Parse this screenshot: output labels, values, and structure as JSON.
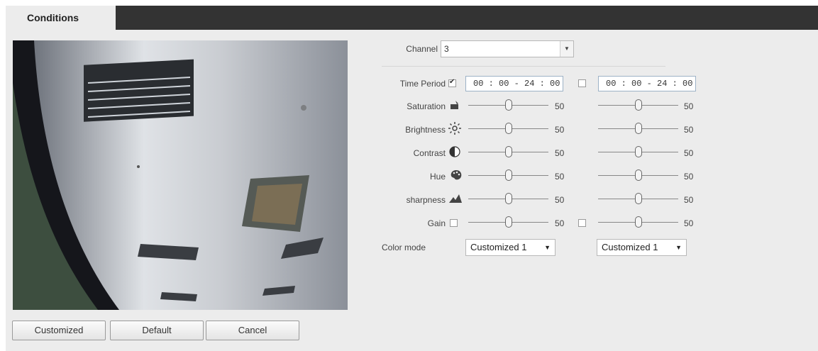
{
  "tabs": [
    {
      "label": "Conditions"
    }
  ],
  "channel": {
    "label": "Channel",
    "value": "3"
  },
  "time_period": {
    "label": "Time Period",
    "col1": {
      "checked": true,
      "value": "00 : 00 - 24 : 00"
    },
    "col2": {
      "checked": false,
      "value": "00 : 00 - 24 : 00"
    }
  },
  "rows": [
    {
      "label": "Saturation",
      "icon": "saturation-icon",
      "col1": 50,
      "col2": 50
    },
    {
      "label": "Brightness",
      "icon": "brightness-icon",
      "col1": 50,
      "col2": 50
    },
    {
      "label": "Contrast",
      "icon": "contrast-icon",
      "col1": 50,
      "col2": 50
    },
    {
      "label": "Hue",
      "icon": "hue-palette-icon",
      "col1": 50,
      "col2": 50
    },
    {
      "label": "sharpness",
      "icon": "sharpness-icon",
      "col1": 50,
      "col2": 50
    },
    {
      "label": "Gain",
      "icon": "gain-checkbox",
      "col1": 50,
      "col2": 50,
      "col1_checked": false,
      "col2_checked": false
    }
  ],
  "color_mode": {
    "label": "Color mode",
    "col1": "Customized 1",
    "col2": "Customized 1"
  },
  "buttons": {
    "customized": "Customized",
    "default": "Default",
    "cancel": "Cancel"
  },
  "slider_max": 100
}
